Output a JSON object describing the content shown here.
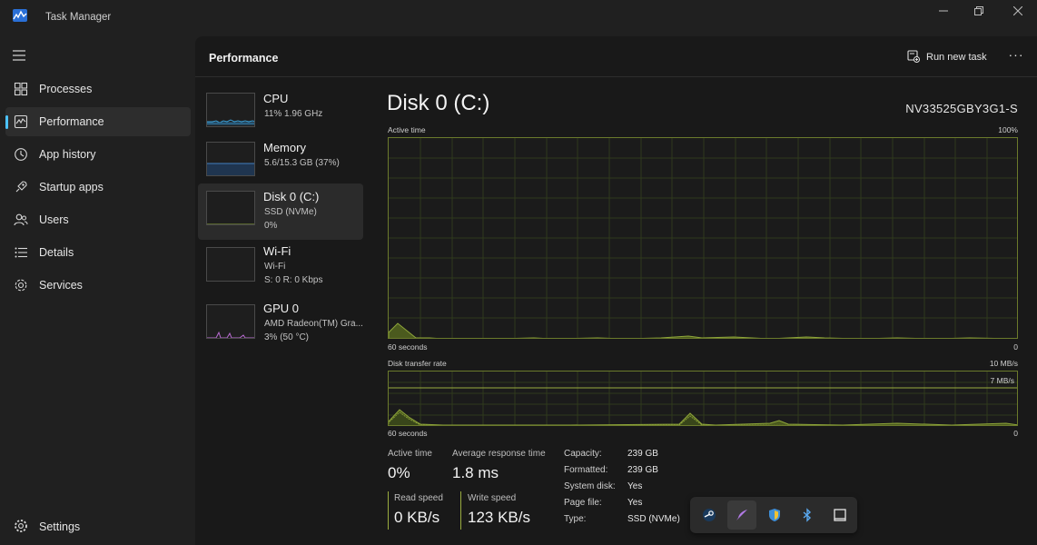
{
  "window": {
    "title": "Task Manager"
  },
  "nav": {
    "items": [
      {
        "label": "Processes",
        "icon": "processes-icon"
      },
      {
        "label": "Performance",
        "icon": "performance-icon",
        "active": true
      },
      {
        "label": "App history",
        "icon": "app-history-icon"
      },
      {
        "label": "Startup apps",
        "icon": "startup-apps-icon"
      },
      {
        "label": "Users",
        "icon": "users-icon"
      },
      {
        "label": "Details",
        "icon": "details-icon"
      },
      {
        "label": "Services",
        "icon": "services-icon"
      }
    ],
    "settings_label": "Settings"
  },
  "header": {
    "title": "Performance",
    "run_new_task": "Run new task",
    "more": "···"
  },
  "devices": [
    {
      "name": "CPU",
      "line1": "11%  1.96 GHz",
      "line2": ""
    },
    {
      "name": "Memory",
      "line1": "5.6/15.3 GB (37%)",
      "line2": ""
    },
    {
      "name": "Disk 0 (C:)",
      "line1": "SSD (NVMe)",
      "line2": "0%",
      "active": true
    },
    {
      "name": "Wi-Fi",
      "line1": "Wi-Fi",
      "line2": "S: 0  R: 0 Kbps"
    },
    {
      "name": "GPU 0",
      "line1": "AMD Radeon(TM) Gra...",
      "line2": "3%  (50 °C)"
    }
  ],
  "detail": {
    "title": "Disk 0 (C:)",
    "model": "NV33525GBY3G1-S",
    "active_graph": {
      "label": "Active time",
      "max": "100%",
      "time": "60 seconds",
      "min": "0"
    },
    "transfer_graph": {
      "label": "Disk transfer rate",
      "max": "10 MB/s",
      "line_label": "7 MB/s",
      "time": "60 seconds",
      "min": "0"
    },
    "stats": {
      "active_time_label": "Active time",
      "active_time": "0%",
      "avg_response_label": "Average response time",
      "avg_response": "1.8 ms",
      "read_label": "Read speed",
      "read": "0 KB/s",
      "write_label": "Write speed",
      "write": "123 KB/s"
    },
    "info": [
      {
        "k": "Capacity:",
        "v": "239 GB"
      },
      {
        "k": "Formatted:",
        "v": "239 GB"
      },
      {
        "k": "System disk:",
        "v": "Yes"
      },
      {
        "k": "Page file:",
        "v": "Yes"
      },
      {
        "k": "Type:",
        "v": "SSD (NVMe)"
      }
    ]
  },
  "tray": {
    "icons": [
      "steam-icon",
      "feather-app-icon",
      "security-shield-icon",
      "bluetooth-icon",
      "window-icon"
    ]
  },
  "colors": {
    "accent": "#4cc2ff",
    "disk_green": "#8fa63a",
    "memory_blue": "#3a6ea5",
    "gpu_purple": "#b86bd1"
  }
}
